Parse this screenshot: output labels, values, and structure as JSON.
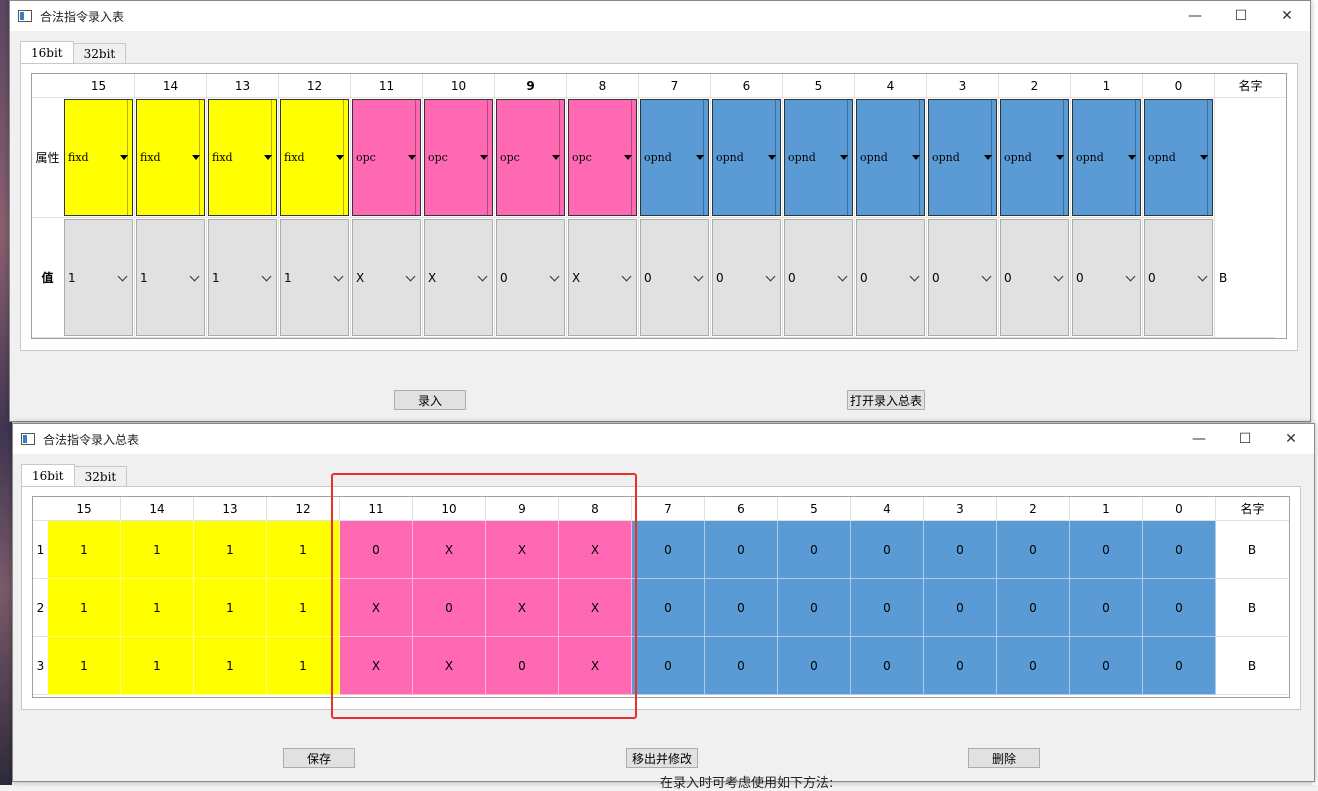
{
  "colors": {
    "fixd": "#ffff00",
    "opc": "#ff69b4",
    "opnd": "#5b9bd5",
    "value_bg": "#e1e1e1",
    "highlight": "#e8302c"
  },
  "win1": {
    "title": "合法指令录入表",
    "tabs": [
      "16bit",
      "32bit"
    ],
    "bit_headers": [
      "15",
      "14",
      "13",
      "12",
      "11",
      "10",
      "9",
      "8",
      "7",
      "6",
      "5",
      "4",
      "3",
      "2",
      "1",
      "0"
    ],
    "name_header": "名字",
    "row_labels": {
      "attr": "属性",
      "value": "值"
    },
    "attributes": [
      "fixd",
      "fixd",
      "fixd",
      "fixd",
      "opc",
      "opc",
      "opc",
      "opc",
      "opnd",
      "opnd",
      "opnd",
      "opnd",
      "opnd",
      "opnd",
      "opnd",
      "opnd"
    ],
    "values": [
      "1",
      "1",
      "1",
      "1",
      "X",
      "X",
      "0",
      "X",
      "0",
      "0",
      "0",
      "0",
      "0",
      "0",
      "0",
      "0"
    ],
    "name_value": "B",
    "buttons": {
      "enter": "录入",
      "open_summary": "打开录入总表"
    }
  },
  "win2": {
    "title": "合法指令录入总表",
    "tabs": [
      "16bit",
      "32bit"
    ],
    "bit_headers": [
      "15",
      "14",
      "13",
      "12",
      "11",
      "10",
      "9",
      "8",
      "7",
      "6",
      "5",
      "4",
      "3",
      "2",
      "1",
      "0"
    ],
    "name_header": "名字",
    "rows": [
      {
        "index": "1",
        "bits": [
          "1",
          "1",
          "1",
          "1",
          "0",
          "X",
          "X",
          "X",
          "0",
          "0",
          "0",
          "0",
          "0",
          "0",
          "0",
          "0"
        ],
        "name": "B"
      },
      {
        "index": "2",
        "bits": [
          "1",
          "1",
          "1",
          "1",
          "X",
          "0",
          "X",
          "X",
          "0",
          "0",
          "0",
          "0",
          "0",
          "0",
          "0",
          "0"
        ],
        "name": "B"
      },
      {
        "index": "3",
        "bits": [
          "1",
          "1",
          "1",
          "1",
          "X",
          "X",
          "0",
          "X",
          "0",
          "0",
          "0",
          "0",
          "0",
          "0",
          "0",
          "0"
        ],
        "name": "B"
      }
    ],
    "buttons": {
      "save": "保存",
      "move_modify": "移出并修改",
      "delete": "删除"
    }
  },
  "background_text": "在录入时可考虑使用如下方法:",
  "window_controls": {
    "minimize": "—",
    "maximize": "☐",
    "close": "✕"
  }
}
